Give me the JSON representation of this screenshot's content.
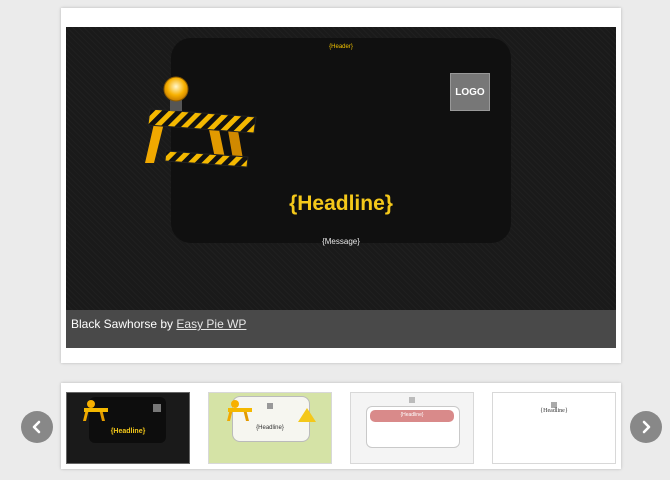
{
  "preview": {
    "header_text": "{Header}",
    "logo_text": "LOGO",
    "headline": "{Headline}",
    "message": "{Message}"
  },
  "caption": {
    "prefix": "Black Sawhorse by ",
    "author_link": "Easy Pie WP"
  },
  "thumbnails": [
    {
      "headline": "{Headline}"
    },
    {
      "headline": "{Headline}"
    },
    {
      "headline": "{Headline}"
    },
    {
      "headline": "{Headline}"
    }
  ],
  "icons": {
    "prev": "chevron-left-icon",
    "next": "chevron-right-icon"
  },
  "colors": {
    "headline_yellow": "#f4c81a",
    "caption_bar": "#494949",
    "nav_button": "#888888",
    "thumb_2_bg": "#d5e3a6",
    "thumb_3_band": "#d98a8a"
  }
}
